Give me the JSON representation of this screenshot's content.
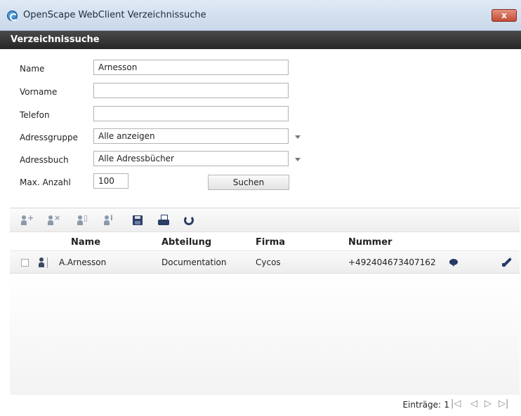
{
  "window": {
    "title": "OpenScape WebClient Verzeichnissuche",
    "close_label": "x"
  },
  "header": {
    "title": "Verzeichnissuche"
  },
  "form": {
    "name_label": "Name",
    "name_value": "Arnesson",
    "vorname_label": "Vorname",
    "vorname_value": "",
    "telefon_label": "Telefon",
    "telefon_value": "",
    "adressgruppe_label": "Adressgruppe",
    "adressgruppe_value": "Alle anzeigen",
    "adressbuch_label": "Adressbuch",
    "adressbuch_value": "Alle Adressbücher",
    "max_label": "Max. Anzahl",
    "max_value": "100",
    "search_label": "Suchen"
  },
  "toolbar": {
    "icons": [
      "add-contact-icon",
      "remove-contact-icon",
      "edit-contact-icon",
      "contact-info-icon",
      "save-icon",
      "print-icon",
      "refresh-icon"
    ],
    "add_mark": "+",
    "remove_mark": "×",
    "edit_mark": "▯",
    "info_mark": "i"
  },
  "table": {
    "columns": [
      "Name",
      "Abteilung",
      "Firma",
      "Nummer"
    ],
    "rows": [
      {
        "name": "A.Arnesson",
        "abteilung": "Documentation",
        "firma": "Cycos",
        "nummer": "+492404673407162"
      }
    ]
  },
  "footer": {
    "entries_label": "Einträge:",
    "entries_count": "1",
    "pager": {
      "first": "|◁",
      "prev": "◁",
      "next": "▷",
      "last": "▷|"
    }
  },
  "colors": {
    "header_bg": "#2f2f2f",
    "accent_icon": "#253a66"
  }
}
